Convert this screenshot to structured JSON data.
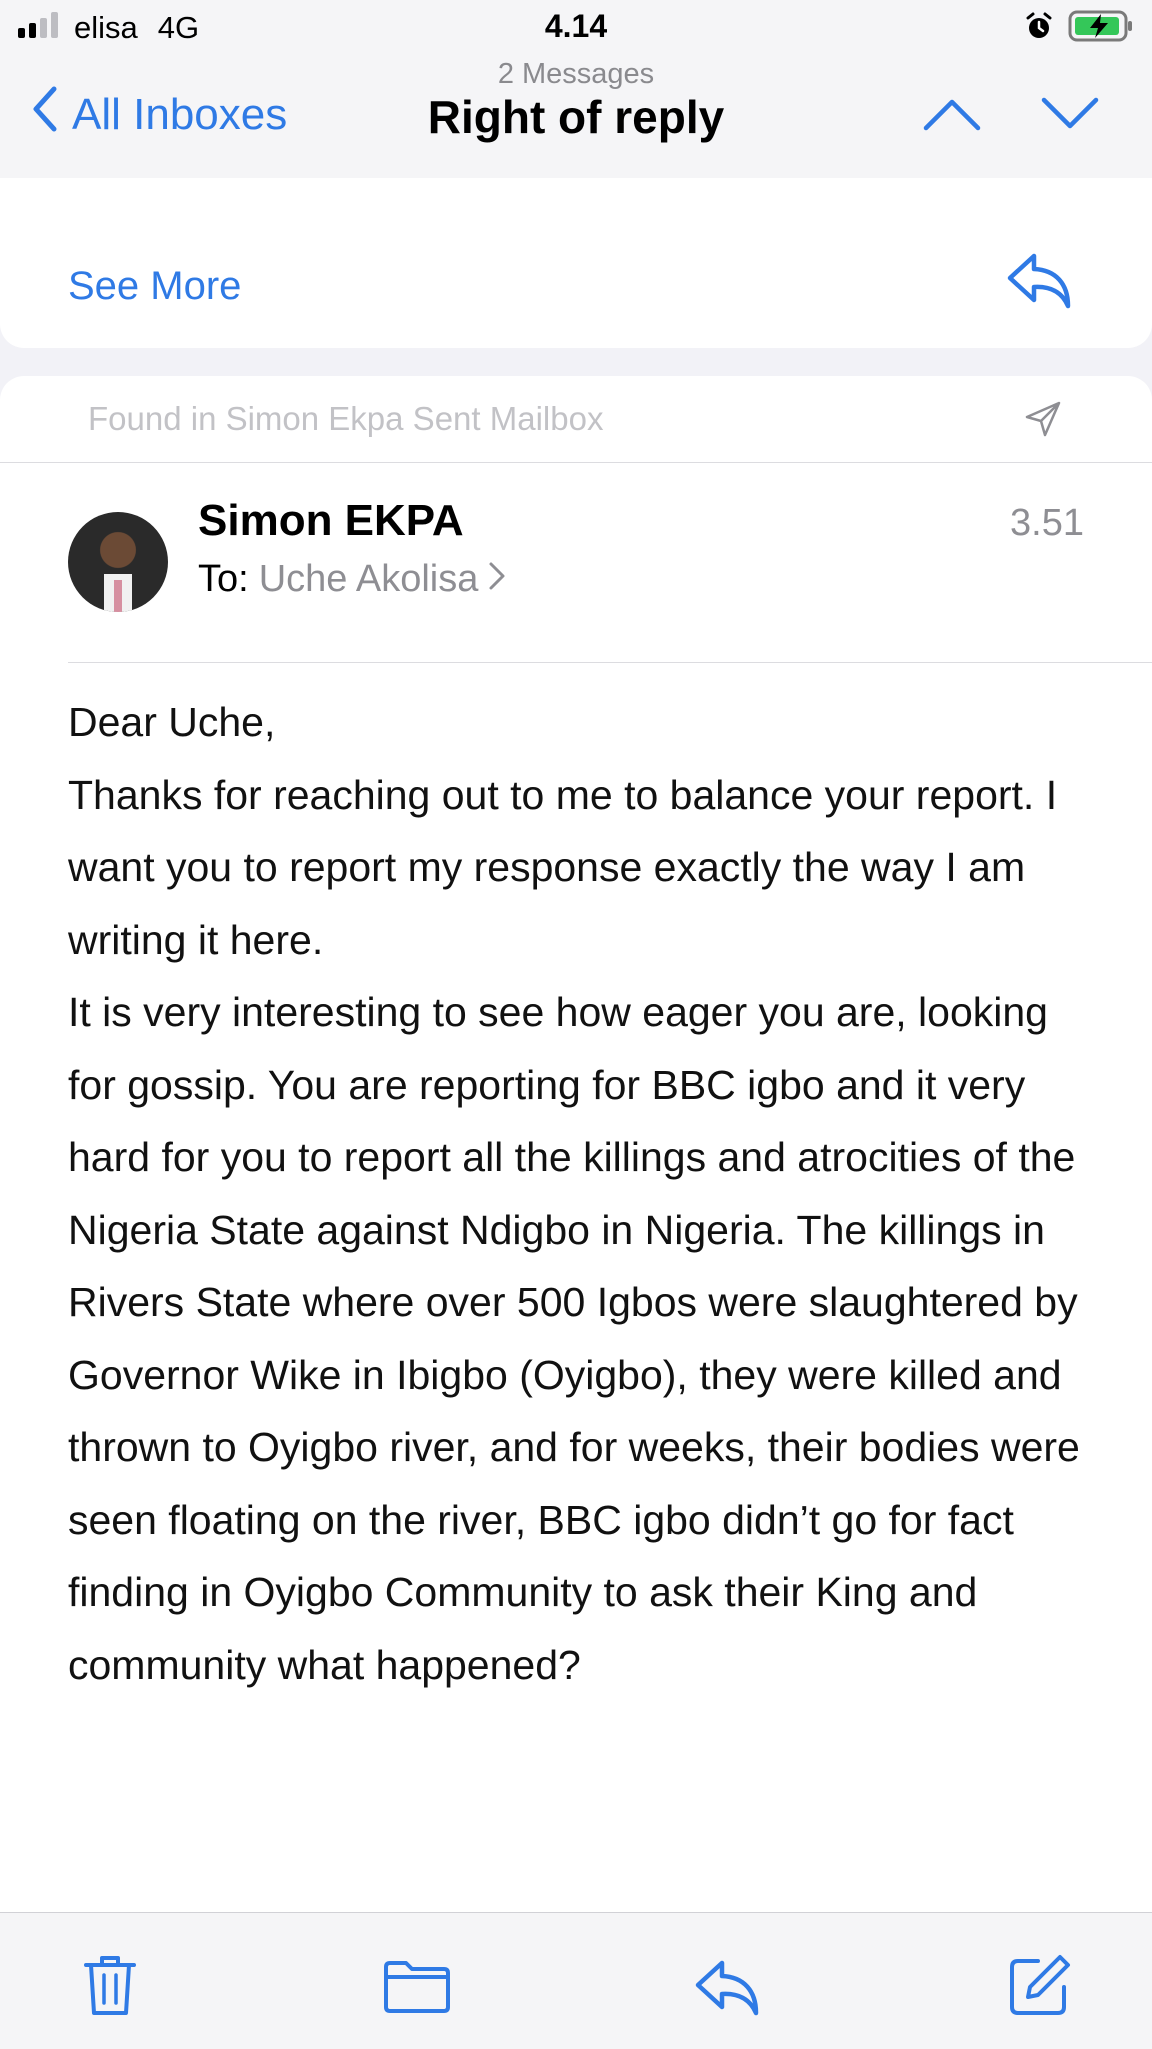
{
  "status_bar": {
    "carrier": "elisa",
    "network": "4G",
    "time": "4.14",
    "icons": [
      "signal-icon",
      "alarm-icon",
      "battery-charging-icon"
    ]
  },
  "nav": {
    "back_label": "All Inboxes",
    "message_count": "2 Messages",
    "title": "Right of reply"
  },
  "thread": {
    "see_more_label": "See More",
    "found_in": "Found in Simon Ekpa Sent Mailbox"
  },
  "message": {
    "sender": "Simon EKPA",
    "to_label": "To:",
    "recipient": "Uche Akolisa",
    "time": "3.51",
    "body": [
      "Dear Uche,",
      "Thanks for reaching out to me to balance your report. I want you to report my response exactly the way I am writing it here.",
      "It is very interesting to see how eager you are, looking for gossip. You are reporting for BBC igbo and it very hard for you to report all the killings and atrocities of the Nigeria State against Ndigbo in Nigeria. The killings in Rivers State where over 500 Igbos were slaughtered by Governor Wike in Ibigbo (Oyigbo), they were killed and thrown to Oyigbo river, and for weeks, their bodies were seen floating on the river, BBC igbo didn’t go for fact finding in Oyigbo Community to ask their King and community what happened?"
    ]
  },
  "toolbar": {
    "icons": [
      "trash-icon",
      "folder-icon",
      "reply-icon",
      "compose-icon"
    ]
  },
  "colors": {
    "accent": "#2f7ae5",
    "secondary_text": "#8e8e93",
    "background": "#f2f2f7"
  }
}
